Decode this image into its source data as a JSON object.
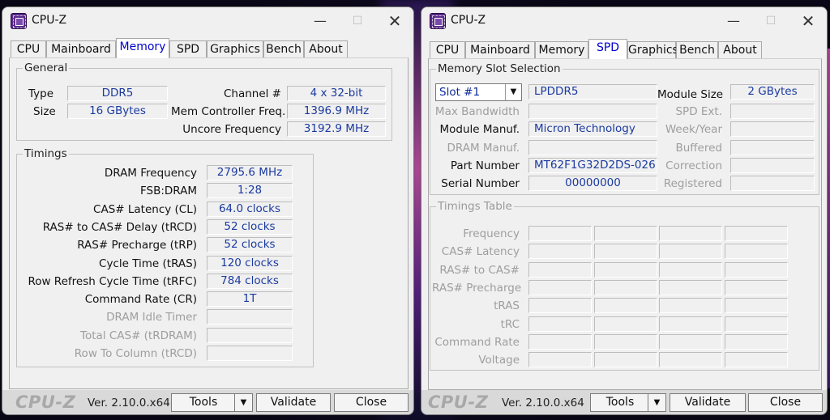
{
  "colors": {
    "value_text": "#1a3aa0",
    "active_tab": "#0000cc",
    "disabled_text": "#9e9e9e"
  },
  "window1": {
    "title": "CPU-Z",
    "tabs": [
      "CPU",
      "Mainboard",
      "Memory",
      "SPD",
      "Graphics",
      "Bench",
      "About"
    ],
    "active_tab": "Memory",
    "general": {
      "title": "General",
      "type_label": "Type",
      "type_value": "DDR5",
      "size_label": "Size",
      "size_value": "16 GBytes",
      "channel_label": "Channel #",
      "channel_value": "4 x 32-bit",
      "mem_ctrl_label": "Mem Controller Freq.",
      "mem_ctrl_value": "1396.9 MHz",
      "uncore_label": "Uncore Frequency",
      "uncore_value": "3192.9 MHz"
    },
    "timings": {
      "title": "Timings",
      "rows": [
        {
          "label": "DRAM Frequency",
          "value": "2795.6 MHz",
          "enabled": true
        },
        {
          "label": "FSB:DRAM",
          "value": "1:28",
          "enabled": true
        },
        {
          "label": "CAS# Latency (CL)",
          "value": "64.0 clocks",
          "enabled": true
        },
        {
          "label": "RAS# to CAS# Delay (tRCD)",
          "value": "52 clocks",
          "enabled": true
        },
        {
          "label": "RAS# Precharge (tRP)",
          "value": "52 clocks",
          "enabled": true
        },
        {
          "label": "Cycle Time (tRAS)",
          "value": "120 clocks",
          "enabled": true
        },
        {
          "label": "Row Refresh Cycle Time (tRFC)",
          "value": "784 clocks",
          "enabled": true
        },
        {
          "label": "Command Rate (CR)",
          "value": "1T",
          "enabled": true
        },
        {
          "label": "DRAM Idle Timer",
          "value": "",
          "enabled": false
        },
        {
          "label": "Total CAS# (tRDRAM)",
          "value": "",
          "enabled": false
        },
        {
          "label": "Row To Column (tRCD)",
          "value": "",
          "enabled": false
        }
      ]
    },
    "bottom": {
      "brand": "CPU-Z",
      "version": "Ver. 2.10.0.x64",
      "tools": "Tools",
      "validate": "Validate",
      "close": "Close"
    }
  },
  "window2": {
    "title": "CPU-Z",
    "tabs": [
      "CPU",
      "Mainboard",
      "Memory",
      "SPD",
      "Graphics",
      "Bench",
      "About"
    ],
    "active_tab": "SPD",
    "slot": {
      "title": "Memory Slot Selection",
      "selected_slot": "Slot #1",
      "memory_type": "LPDDR5",
      "module_size_label": "Module Size",
      "module_size_value": "2 GBytes",
      "max_bw_label": "Max Bandwidth",
      "max_bw_value": "",
      "spd_ext_label": "SPD Ext.",
      "spd_ext_value": "",
      "module_manuf_label": "Module Manuf.",
      "module_manuf_value": "Micron Technology",
      "week_year_label": "Week/Year",
      "week_year_value": "",
      "dram_manuf_label": "DRAM Manuf.",
      "dram_manuf_value": "",
      "buffered_label": "Buffered",
      "buffered_value": "",
      "part_label": "Part Number",
      "part_value": "MT62F1G32D2DS-026",
      "correction_label": "Correction",
      "correction_value": "",
      "serial_label": "Serial Number",
      "serial_value": "00000000",
      "registered_label": "Registered",
      "registered_value": ""
    },
    "timings_table": {
      "title": "Timings Table",
      "rows": [
        "Frequency",
        "CAS# Latency",
        "RAS# to CAS#",
        "RAS# Precharge",
        "tRAS",
        "tRC",
        "Command Rate",
        "Voltage"
      ]
    },
    "bottom": {
      "brand": "CPU-Z",
      "version": "Ver. 2.10.0.x64",
      "tools": "Tools",
      "validate": "Validate",
      "close": "Close"
    }
  }
}
